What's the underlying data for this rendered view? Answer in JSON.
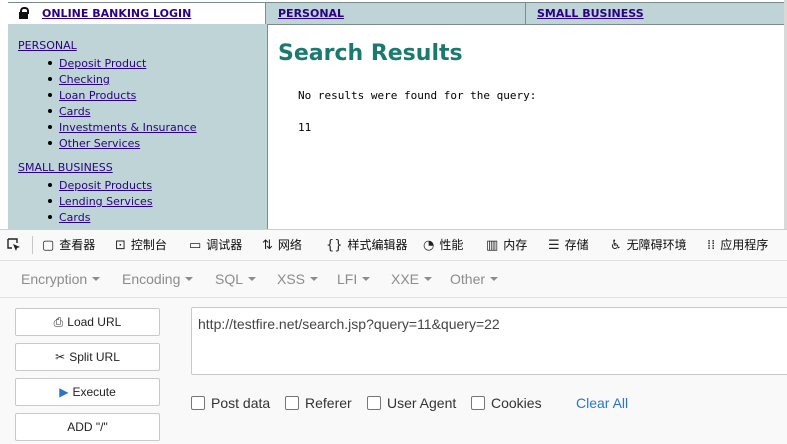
{
  "page": {
    "tabs": {
      "login": "ONLINE BANKING LOGIN",
      "personal": "PERSONAL",
      "small_business": "SMALL BUSINESS"
    },
    "sidebar": {
      "personal_heading": "PERSONAL",
      "personal_items": [
        "Deposit Product",
        "Checking",
        "Loan Products",
        "Cards",
        "Investments & Insurance",
        "Other Services"
      ],
      "business_heading": "SMALL BUSINESS",
      "business_items": [
        "Deposit Products",
        "Lending Services",
        "Cards"
      ]
    },
    "content": {
      "title": "Search Results",
      "message": "No results were found for the query:",
      "query_value": "11"
    }
  },
  "devtools": {
    "tabs": [
      {
        "icon": "inspector-icon",
        "label": "查看器"
      },
      {
        "icon": "console-icon",
        "label": "控制台"
      },
      {
        "icon": "debugger-icon",
        "label": "调试器"
      },
      {
        "icon": "network-icon",
        "label": "网络"
      },
      {
        "icon": "style-editor-icon",
        "label": "样式编辑器"
      },
      {
        "icon": "performance-icon",
        "label": "性能"
      },
      {
        "icon": "memory-icon",
        "label": "内存"
      },
      {
        "icon": "storage-icon",
        "label": "存储"
      },
      {
        "icon": "accessibility-icon",
        "label": "无障碍环境"
      },
      {
        "icon": "application-icon",
        "label": "应用程序"
      }
    ]
  },
  "hackbar": {
    "menu": [
      "Encryption",
      "Encoding",
      "SQL",
      "XSS",
      "LFI",
      "XXE",
      "Other"
    ],
    "buttons": {
      "load_url": "Load URL",
      "split_url": "Split URL",
      "execute": "Execute",
      "add_slash": "ADD \"/\""
    },
    "url": "http://testfire.net/search.jsp?query=11&query=22",
    "options": [
      "Post data",
      "Referer",
      "User Agent",
      "Cookies"
    ],
    "clear_all": "Clear All"
  }
}
